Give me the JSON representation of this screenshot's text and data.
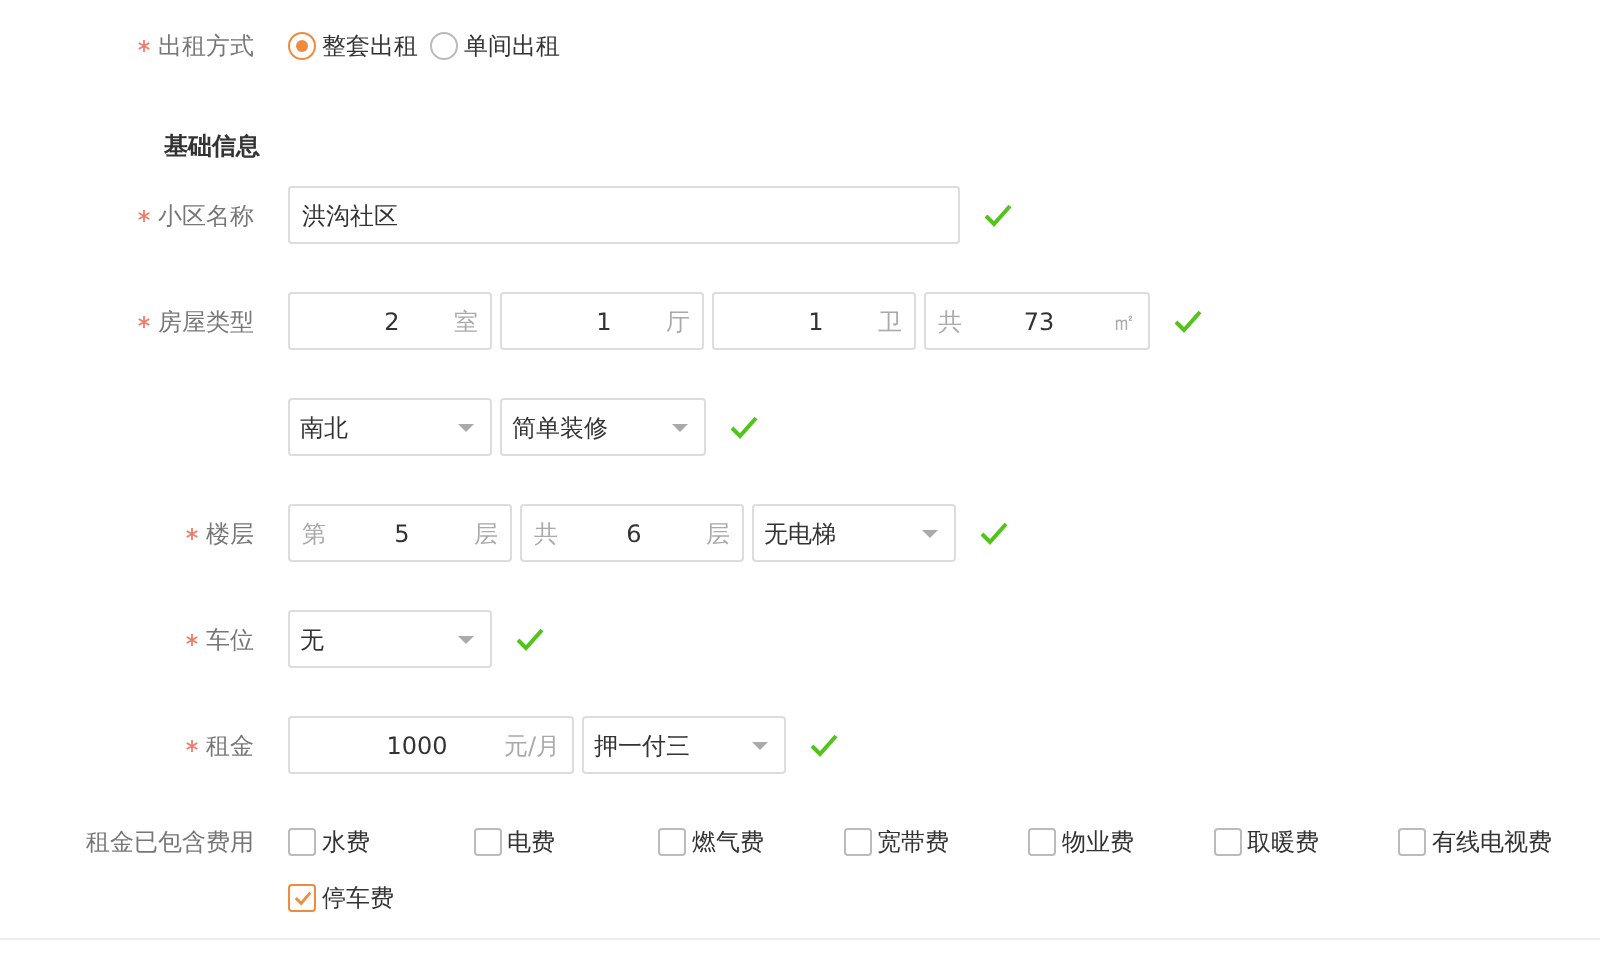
{
  "rent_type": {
    "label": "出租方式",
    "required": true,
    "options": [
      {
        "label": "整套出租",
        "selected": true
      },
      {
        "label": "单间出租",
        "selected": false
      }
    ]
  },
  "section_title": "基础信息",
  "rows": [
    {
      "label": "小区名称",
      "required": true,
      "valid": true,
      "fields": [
        {
          "kind": "text",
          "value": "洪沟社区"
        }
      ]
    },
    {
      "label": "房屋类型",
      "required": true,
      "valid": true,
      "fields": [
        {
          "kind": "number",
          "value": "2",
          "suffix": "室"
        },
        {
          "kind": "number",
          "value": "1",
          "suffix": "厅"
        },
        {
          "kind": "number",
          "value": "1",
          "suffix": "卫"
        },
        {
          "kind": "number",
          "prefix": "共",
          "value": "73",
          "suffix": "㎡"
        }
      ]
    },
    {
      "valid": true,
      "fields": [
        {
          "kind": "select",
          "value": "南北"
        },
        {
          "kind": "select",
          "value": "简单装修"
        }
      ]
    },
    {
      "label": "楼层",
      "required": true,
      "valid": true,
      "fields": [
        {
          "kind": "number",
          "prefix": "第",
          "value": "5",
          "suffix": "层"
        },
        {
          "kind": "number",
          "prefix": "共",
          "value": "6",
          "suffix": "层"
        },
        {
          "kind": "select",
          "value": "无电梯"
        }
      ]
    },
    {
      "label": "车位",
      "required": true,
      "valid": true,
      "fields": [
        {
          "kind": "select",
          "value": "无"
        }
      ]
    },
    {
      "label": "租金",
      "required": true,
      "valid": true,
      "fields": [
        {
          "kind": "number",
          "value": "1000",
          "suffix": "元/月"
        },
        {
          "kind": "select",
          "value": "押一付三"
        }
      ]
    }
  ],
  "fees": {
    "label": "租金已包含费用",
    "options": [
      {
        "label": "水费",
        "checked": false
      },
      {
        "label": "电费",
        "checked": false
      },
      {
        "label": "燃气费",
        "checked": false
      },
      {
        "label": "宽带费",
        "checked": false
      },
      {
        "label": "物业费",
        "checked": false
      },
      {
        "label": "取暖费",
        "checked": false
      },
      {
        "label": "有线电视费",
        "checked": false
      },
      {
        "label": "停车费",
        "checked": true
      }
    ]
  }
}
